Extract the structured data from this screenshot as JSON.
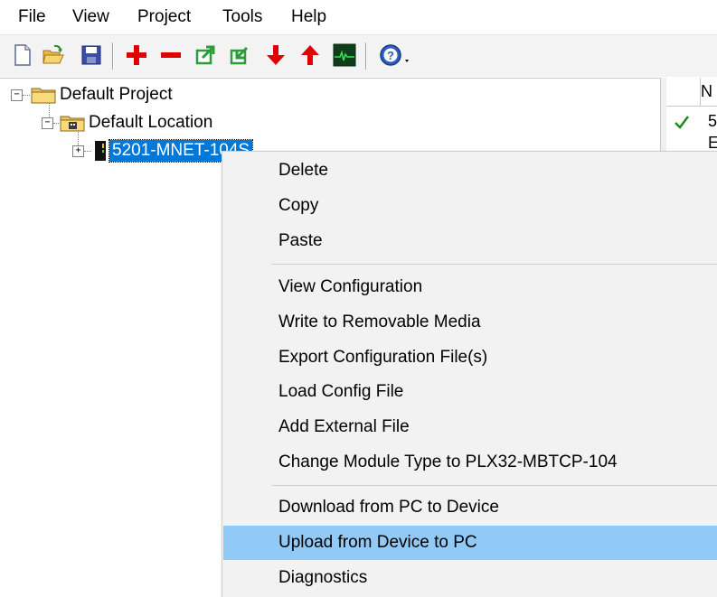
{
  "menubar": {
    "items": [
      "File",
      "View",
      "Project",
      "Tools",
      "Help"
    ]
  },
  "toolbar": {
    "buttons": [
      {
        "name": "new-file-icon"
      },
      {
        "name": "open-folder-icon"
      },
      {
        "name": "save-icon"
      },
      {
        "name": "add-icon",
        "color": "#e00000"
      },
      {
        "name": "remove-icon",
        "color": "#e00000"
      },
      {
        "name": "export-icon",
        "color": "#2a9d3a"
      },
      {
        "name": "import-icon",
        "color": "#2a9d3a"
      },
      {
        "name": "arrow-down-icon",
        "color": "#e00000"
      },
      {
        "name": "arrow-up-icon",
        "color": "#e00000"
      },
      {
        "name": "monitor-icon",
        "color": "#1e7a2e"
      },
      {
        "name": "help-icon",
        "color": "#1f4fa8"
      }
    ]
  },
  "tree": {
    "project": "Default Project",
    "location": "Default Location",
    "module": "5201-MNET-104S"
  },
  "grid": {
    "header_col": "N",
    "row1": "5",
    "row2": "E"
  },
  "context_menu": {
    "items": [
      "Delete",
      "Copy",
      "Paste",
      "View Configuration",
      "Write to Removable Media",
      "Export Configuration File(s)",
      "Load Config File",
      "Add External File",
      "Change Module Type to PLX32-MBTCP-104",
      "Download from PC to Device",
      "Upload from Device to PC",
      "Diagnostics"
    ],
    "highlighted": "Upload from Device to PC",
    "highlight_color": "#91c9f7"
  }
}
